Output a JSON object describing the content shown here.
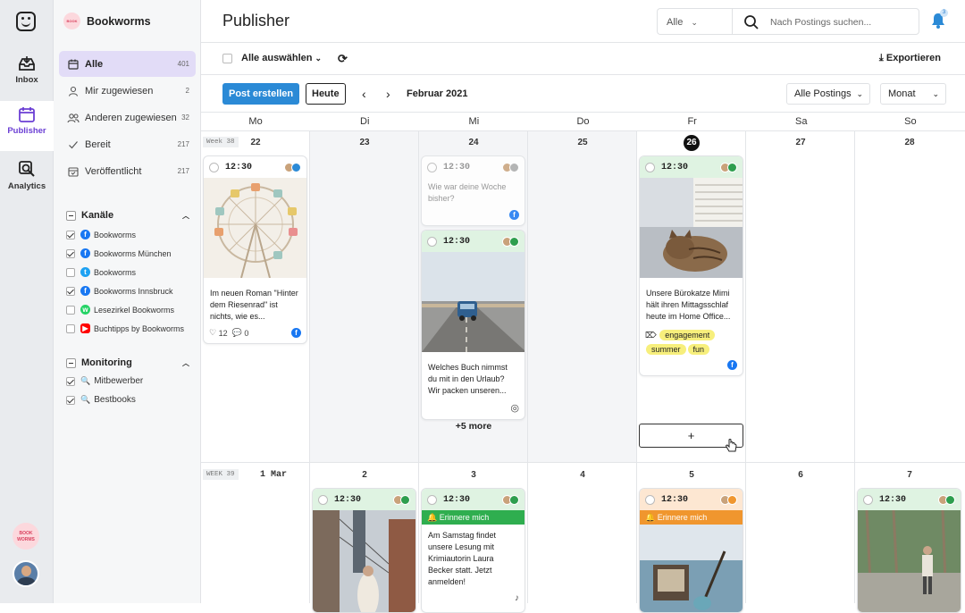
{
  "rail": {
    "items": [
      {
        "label": "Inbox"
      },
      {
        "label": "Publisher"
      },
      {
        "label": "Analytics"
      }
    ],
    "accent": "#6b3fd4",
    "brand_avatar_text": "BOOK WORMS"
  },
  "sidebar": {
    "brand": "Bookworms",
    "nav": [
      {
        "label": "Alle",
        "count": "401"
      },
      {
        "label": "Mir zugewiesen",
        "count": "2"
      },
      {
        "label": "Anderen zugewiesen",
        "count": "32"
      },
      {
        "label": "Bereit",
        "count": "217"
      },
      {
        "label": "Veröffentlicht",
        "count": "217"
      }
    ],
    "channels_title": "Kanäle",
    "channels": [
      {
        "label": "Bookworms",
        "network": "facebook"
      },
      {
        "label": "Bookworms München",
        "network": "facebook"
      },
      {
        "label": "Bookworms",
        "network": "twitter"
      },
      {
        "label": "Bookworms Innsbruck",
        "network": "facebook"
      },
      {
        "label": "Lesezirkel Bookworms",
        "network": "whatsapp"
      },
      {
        "label": "Buchtipps by Bookworms",
        "network": "youtube"
      }
    ],
    "monitoring_title": "Monitoring",
    "monitoring": [
      {
        "label": "Mitbewerber"
      },
      {
        "label": "Bestbooks"
      }
    ]
  },
  "header": {
    "title": "Publisher",
    "filter_value": "Alle",
    "search_placeholder": "Nach Postings suchen...",
    "notification_count": "3"
  },
  "toolbar": {
    "select_all": "Alle auswählen",
    "export": "Exportieren",
    "create_post": "Post erstellen",
    "today": "Heute",
    "month_label": "Februar 2021",
    "filter_posts": "Alle Postings",
    "view_mode": "Monat"
  },
  "calendar": {
    "weekdays": [
      "Mo",
      "Di",
      "Mi",
      "Do",
      "Fr",
      "Sa",
      "So"
    ],
    "week1_label": "Week 38",
    "week2_label": "WEEK 39",
    "week1_days": [
      "22",
      "23",
      "24",
      "25",
      "26",
      "27",
      "28"
    ],
    "week2_days": [
      "1 Mar",
      "2",
      "3",
      "4",
      "5",
      "6",
      "7"
    ],
    "more_label": "+5 more",
    "add_label": "+"
  },
  "posts": {
    "mo22": {
      "time": "12:30",
      "text": "Im neuen Roman \"Hinter dem Riesenrad\" ist nichts, wie es...",
      "likes": "12",
      "comments": "0"
    },
    "mi24a": {
      "time": "12:30",
      "text": "Wie war deine Woche bisher?"
    },
    "mi24b": {
      "time": "12:30",
      "text": "Welches Buch nimmst du mit in den Urlaub? Wir packen unseren..."
    },
    "fr26": {
      "time": "12:30",
      "text": "Unsere Bürokatze Mimi hält ihren Mittagsschlaf heute im Home Office...",
      "tags": [
        "engagement",
        "summer",
        "fun"
      ]
    },
    "di2": {
      "time": "12:30"
    },
    "mi3": {
      "time": "12:30",
      "reminder": "Erinnere mich",
      "text": "Am Samstag findet unsere Lesung mit Krimiautorin Laura Becker statt. Jetzt anmelden!"
    },
    "fr5": {
      "time": "12:30",
      "reminder": "Erinnere mich"
    },
    "so7": {
      "time": "12:30"
    }
  }
}
